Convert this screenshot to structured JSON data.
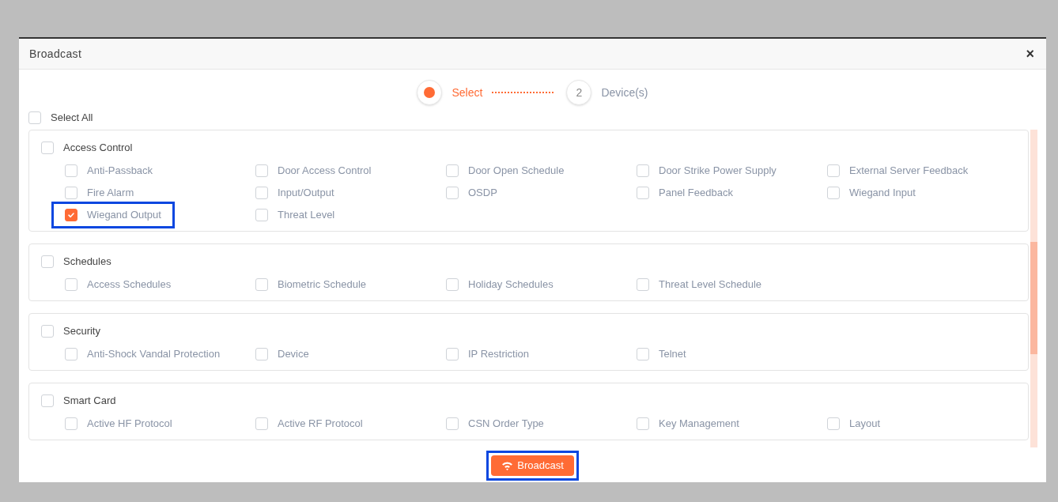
{
  "dialog": {
    "title": "Broadcast",
    "close": "×"
  },
  "steps": [
    {
      "label": "Select",
      "selected": true
    },
    {
      "number": "2",
      "label": "Device(s)",
      "selected": false
    }
  ],
  "select_all": {
    "label": "Select All",
    "checked": false
  },
  "groups": [
    {
      "label": "Access Control",
      "checked": false,
      "items": [
        {
          "label": "Anti-Passback",
          "checked": false,
          "highlighted": false
        },
        {
          "label": "Door Access Control",
          "checked": false,
          "highlighted": false
        },
        {
          "label": "Door Open Schedule",
          "checked": false,
          "highlighted": false
        },
        {
          "label": "Door Strike Power Supply",
          "checked": false,
          "highlighted": false
        },
        {
          "label": "External Server Feedback",
          "checked": false,
          "highlighted": false
        },
        {
          "label": "Fire Alarm",
          "checked": false,
          "highlighted": false
        },
        {
          "label": "Input/Output",
          "checked": false,
          "highlighted": false
        },
        {
          "label": "OSDP",
          "checked": false,
          "highlighted": false
        },
        {
          "label": "Panel Feedback",
          "checked": false,
          "highlighted": false
        },
        {
          "label": "Wiegand Input",
          "checked": false,
          "highlighted": false
        },
        {
          "label": "Wiegand Output",
          "checked": true,
          "highlighted": true
        },
        {
          "label": "Threat Level",
          "checked": false,
          "highlighted": false
        }
      ]
    },
    {
      "label": "Schedules",
      "checked": false,
      "items": [
        {
          "label": "Access Schedules",
          "checked": false,
          "highlighted": false
        },
        {
          "label": "Biometric Schedule",
          "checked": false,
          "highlighted": false
        },
        {
          "label": "Holiday Schedules",
          "checked": false,
          "highlighted": false
        },
        {
          "label": "Threat Level Schedule",
          "checked": false,
          "highlighted": false
        }
      ]
    },
    {
      "label": "Security",
      "checked": false,
      "items": [
        {
          "label": "Anti-Shock Vandal Protection",
          "checked": false,
          "highlighted": false
        },
        {
          "label": "Device",
          "checked": false,
          "highlighted": false
        },
        {
          "label": "IP Restriction",
          "checked": false,
          "highlighted": false
        },
        {
          "label": "Telnet",
          "checked": false,
          "highlighted": false
        }
      ]
    },
    {
      "label": "Smart Card",
      "checked": false,
      "items": [
        {
          "label": "Active HF Protocol",
          "checked": false,
          "highlighted": false
        },
        {
          "label": "Active RF Protocol",
          "checked": false,
          "highlighted": false
        },
        {
          "label": "CSN Order Type",
          "checked": false,
          "highlighted": false
        },
        {
          "label": "Key Management",
          "checked": false,
          "highlighted": false
        },
        {
          "label": "Layout",
          "checked": false,
          "highlighted": false
        }
      ]
    }
  ],
  "broadcast_button": {
    "label": "Broadcast",
    "highlighted": true
  }
}
